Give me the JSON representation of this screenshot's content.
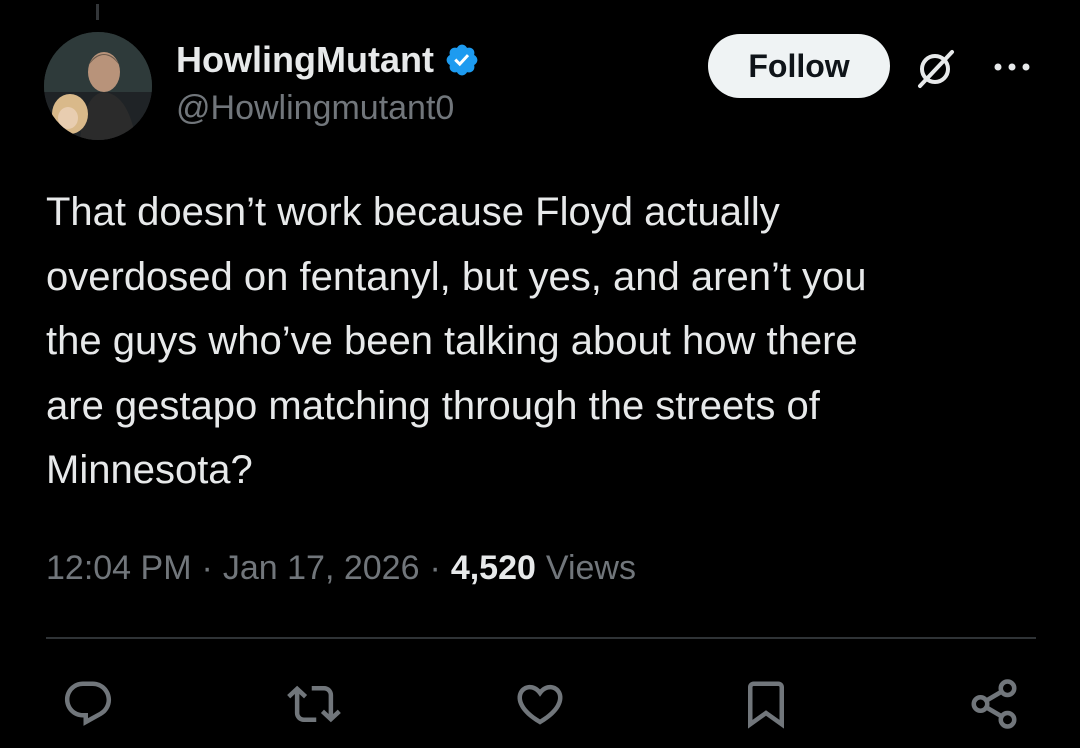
{
  "author": {
    "display_name": "HowlingMutant",
    "handle": "@Howlingmutant0",
    "verified": true
  },
  "buttons": {
    "follow_label": "Follow"
  },
  "tweet": {
    "text": "That doesn’t work because Floyd actually\noverdosed on fentanyl, but yes, and aren’t you\nthe guys who’ve been talking about how there\nare gestapo matching through the streets of\nMinnesota?",
    "time": "12:04 PM",
    "separator": "·",
    "date": "Jan 17, 2026",
    "views_count": "4,520",
    "views_label": "Views"
  },
  "icons": {
    "verified": "verified-badge-icon",
    "grok": "grok-icon",
    "more": "more-options-icon",
    "reply": "reply-icon",
    "retweet": "retweet-icon",
    "like": "like-icon",
    "bookmark": "bookmark-icon",
    "share": "share-icon"
  },
  "colors": {
    "background": "#000000",
    "primary_text": "#e7e9ea",
    "secondary_text": "#71767b",
    "verified_blue": "#1d9bf0",
    "follow_bg": "#eff3f4",
    "divider": "#2f3336"
  }
}
